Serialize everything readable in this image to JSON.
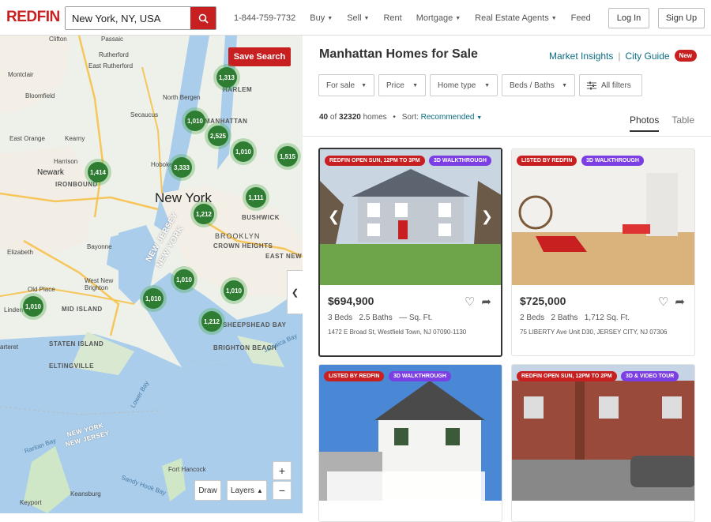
{
  "header": {
    "logo": "REDFIN",
    "search_value": "New York, NY, USA",
    "phone": "1-844-759-7732",
    "nav": [
      {
        "label": "Buy",
        "dropdown": true
      },
      {
        "label": "Sell",
        "dropdown": true
      },
      {
        "label": "Rent",
        "dropdown": false
      },
      {
        "label": "Mortgage",
        "dropdown": true
      },
      {
        "label": "Real Estate Agents",
        "dropdown": true
      },
      {
        "label": "Feed",
        "dropdown": false
      }
    ],
    "login": "Log In",
    "signup": "Sign Up"
  },
  "map": {
    "save_search": "Save Search",
    "draw": "Draw",
    "layers": "Layers",
    "zoom_in": "+",
    "zoom_out": "−",
    "clusters": [
      "1,313",
      "1,010",
      "2,525",
      "1,010",
      "1,515",
      "1,414",
      "3,333",
      "1,111",
      "1,212",
      "1,010",
      "1,010",
      "1,010",
      "1,010",
      "1,212"
    ],
    "labels": [
      "Clifton",
      "Passaic",
      "Rutherford",
      "East Rutherford",
      "Montclair",
      "Bloomfield",
      "North Bergen",
      "Secaucus",
      "MANHATTAN",
      "HARLEM",
      "East Orange",
      "Kearny",
      "Harrison",
      "Newark",
      "IRONBOUND",
      "Hoboken",
      "New York",
      "BUSHWICK",
      "BROOKLYN",
      "CROWN HEIGHTS",
      "EAST NEW YORK",
      "Elizabeth",
      "Bayonne",
      "NEW JERSEY",
      "NEW YORK",
      "West New Brighton",
      "Old Place",
      "MID ISLAND",
      "Linden",
      "SHEEPSHEAD BAY",
      "BRIGHTON BEACH",
      "STATEN ISLAND",
      "arteret",
      "ELTINGVILLE",
      "Lower Bay",
      "Raritan Bay",
      "NEW YORK",
      "NEW JERSEY",
      "Fort Hancock",
      "Sandy Hook Bay",
      "Keansburg",
      "Keyport",
      "Jamaica Bay"
    ]
  },
  "panel": {
    "title": "Manhattan Homes for Sale",
    "market_insights": "Market Insights",
    "separator": "|",
    "city_guide": "City Guide",
    "new_badge": "New",
    "filters": [
      "For sale",
      "Price",
      "Home type",
      "Beds / Baths",
      "All filters"
    ],
    "count_shown": "40",
    "count_of": "of",
    "count_total": "32320",
    "count_unit": "homes",
    "bullet": "•",
    "sort_label": "Sort:",
    "sort_value": "Recommended",
    "tabs": [
      "Photos",
      "Table"
    ]
  },
  "listings": [
    {
      "tags": [
        "REDFIN OPEN SUN, 12PM TO 3PM",
        "3D WALKTHROUGH"
      ],
      "price": "$694,900",
      "beds": "3 Beds",
      "baths": "2.5 Baths",
      "sqft": "— Sq. Ft.",
      "address": "1472 E Broad St, Westfield Town, NJ 07090-1130"
    },
    {
      "tags": [
        "LISTED BY REDFIN",
        "3D WALKTHROUGH"
      ],
      "price": "$725,000",
      "beds": "2 Beds",
      "baths": "2 Baths",
      "sqft": "1,712 Sq. Ft.",
      "address": "75 LIBERTY Ave Unit D30, JERSEY CITY, NJ 07306"
    },
    {
      "tags": [
        "LISTED BY REDFIN",
        "3D WALKTHROUGH"
      ],
      "price": "",
      "beds": "",
      "baths": "",
      "sqft": "",
      "address": ""
    },
    {
      "tags": [
        "REDFIN OPEN SUN, 12PM TO 2PM",
        "3D & VIDEO TOUR"
      ],
      "price": "",
      "beds": "",
      "baths": "",
      "sqft": "",
      "address": ""
    }
  ],
  "colors": {
    "brand": "#c82021",
    "link": "#0b6d84",
    "tag_purple": "#7b3fe4",
    "cluster": "#2e7d32"
  }
}
